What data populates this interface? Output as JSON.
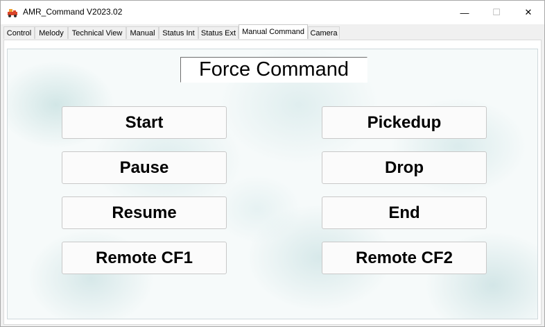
{
  "window": {
    "title": "AMR_Command V2023.02",
    "minimize_glyph": "—",
    "maximize_glyph": "☐",
    "close_glyph": "✕"
  },
  "tabs": [
    {
      "label": "Control"
    },
    {
      "label": "Melody"
    },
    {
      "label": "Technical View"
    },
    {
      "label": "Manual"
    },
    {
      "label": "Status Int"
    },
    {
      "label": "Status Ext"
    },
    {
      "label": "Manual Command",
      "active": true
    },
    {
      "label": "Camera"
    }
  ],
  "panel": {
    "heading": "Force Command",
    "left_buttons": [
      "Start",
      "Pause",
      "Resume",
      "Remote CF1"
    ],
    "right_buttons": [
      "Pickedup",
      "Drop",
      "End",
      "Remote CF2"
    ]
  },
  "colors": {
    "icon_red": "#d9442a",
    "icon_orange": "#f0a030",
    "watercolor": "#b8d8d8"
  },
  "icons": {
    "app": "truck-icon"
  }
}
